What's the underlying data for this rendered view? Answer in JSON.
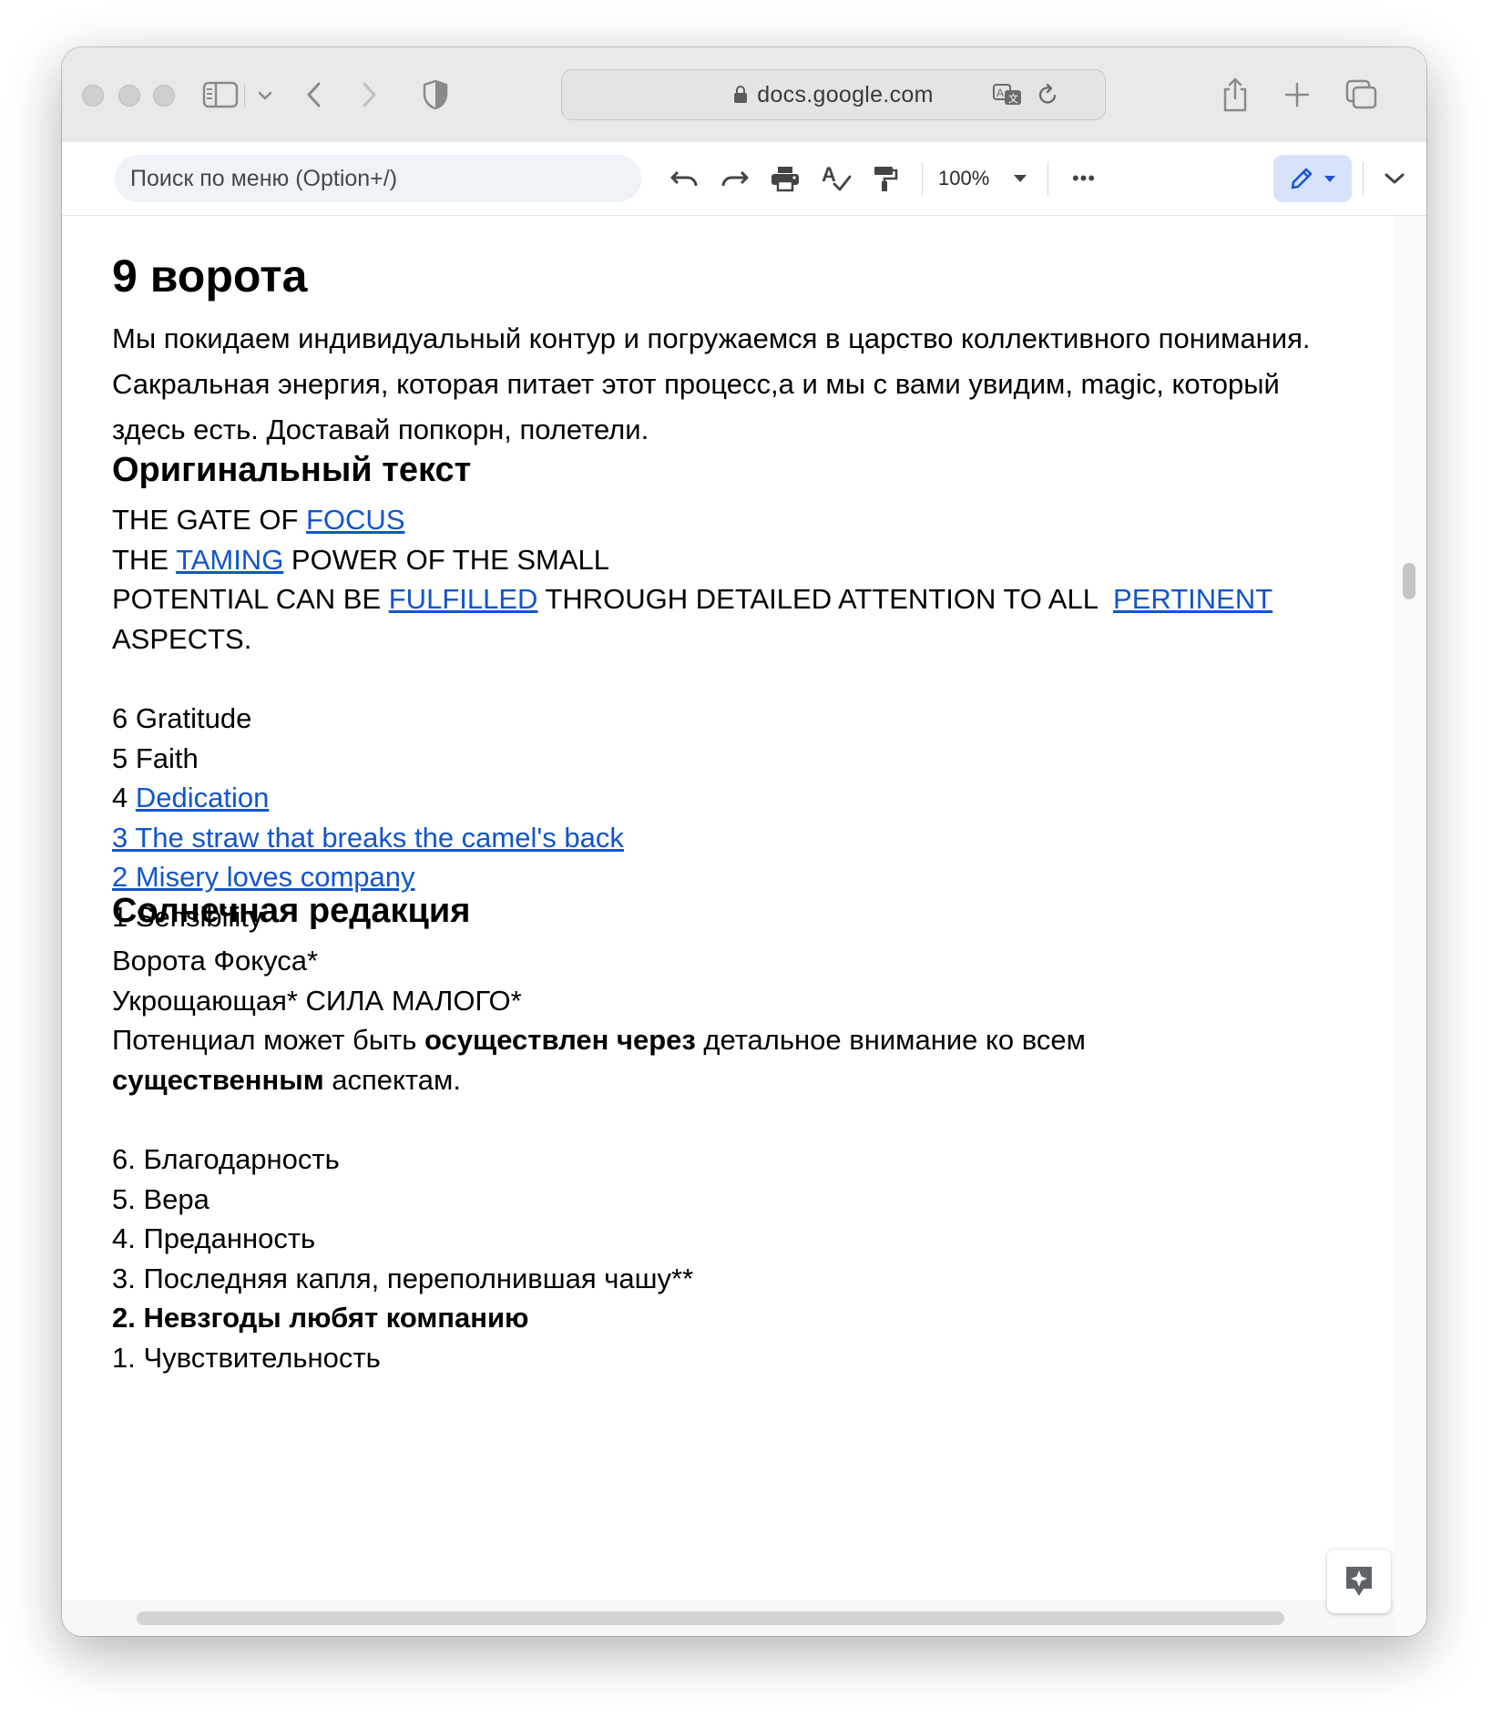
{
  "browser": {
    "url": "docs.google.com"
  },
  "toolbar": {
    "menu_search_placeholder": "Поиск по меню (Option+/)",
    "zoom": "100%",
    "more": "•••"
  },
  "document": {
    "title": "9 ворота",
    "intro": "Мы покидаем индивидуальный контур и погружаемся в царство коллективного понимания. Сакральная энергия, которая питает этот процесс,а и мы с вами увидим, magic, который здесь есть. Доставай попкорн, полетели.",
    "original": {
      "heading": "Оригинальный текст",
      "line1_prefix": "THE GATE OF ",
      "line1_link": "FOCUS",
      "line2_prefix": "THE ",
      "line2_link": "TAMING",
      "line2_suffix": " POWER OF THE SMALL",
      "line3_prefix": "POTENTIAL CAN BE ",
      "line3_link1": "FULFILLED",
      "line3_middle": " THROUGH DETAILED ATTENTION TO ALL  ",
      "line3_link2": "PERTINENT",
      "line4": "ASPECTS.",
      "lines": {
        "l6": "6 Gratitude",
        "l5": "5 Faith",
        "l4_prefix": "4 ",
        "l4_link": "Dedication",
        "l3_link": "3 The straw that breaks the camel's back",
        "l2_link": "2 Misery loves company",
        "l1": "1 Sensibility"
      }
    },
    "solar": {
      "heading": "Солнечная редакция",
      "line1": "Ворота Фокуса*",
      "line2": "Укрощающая* СИЛА МАЛОГО*",
      "line3_prefix": "Потенциал может быть ",
      "line3_bold": "осуществлен через",
      "line3_suffix": " детальное внимание ко всем",
      "line4_bold": "существенным",
      "line4_suffix": " аспектам.",
      "lines": {
        "l6": "6. Благодарность",
        "l5": "5. Вера",
        "l4": "4. Преданность",
        "l3": "3. Последняя капля, переполнившая чашу**",
        "l2": "2. Невзгоды любят компанию",
        "l1": "1. Чувствительность"
      }
    }
  },
  "colors": {
    "link": "#1155cc",
    "edit_mode_bg": "#d6e3fb",
    "edit_mode_icon": "#1a56d6"
  },
  "icons": {
    "address_lock": "lock-icon",
    "explore": "explore-sparkle-icon"
  }
}
